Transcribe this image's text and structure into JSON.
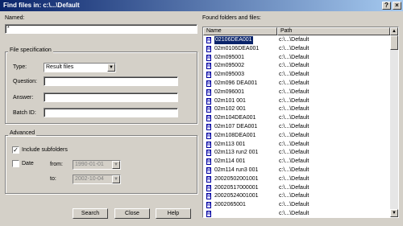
{
  "window": {
    "title": "Find files in: c:\\...\\Default"
  },
  "named": {
    "label": "Named:",
    "value": "*"
  },
  "file_spec": {
    "group_label": "File specification",
    "type_label": "Type:",
    "type_value": "Result files",
    "question_label": "Question:",
    "answer_label": "Answer:",
    "batch_label": "Batch ID:"
  },
  "advanced": {
    "group_label": "Advanced",
    "include_subfolders_label": "Include subfolders",
    "include_subfolders_checked": true,
    "date_label": "Date",
    "date_checked": false,
    "from_label": "from:",
    "from_value": "1990-01-01",
    "to_label": "to:",
    "to_value": "2002-10-04"
  },
  "buttons": {
    "search": "Search",
    "close": "Close",
    "help": "Help"
  },
  "results": {
    "label": "Found folders and files:",
    "columns": [
      "Name",
      "Path"
    ],
    "rows": [
      {
        "name": "02106DEA001",
        "path": "c:\\...\\Default"
      },
      {
        "name": "02m0106DEA001",
        "path": "c:\\...\\Default"
      },
      {
        "name": "02m095001",
        "path": "c:\\...\\Default"
      },
      {
        "name": "02m095002",
        "path": "c:\\...\\Default"
      },
      {
        "name": "02m095003",
        "path": "c:\\...\\Default"
      },
      {
        "name": "02m096 DEA001",
        "path": "c:\\...\\Default"
      },
      {
        "name": "02m096001",
        "path": "c:\\...\\Default"
      },
      {
        "name": "02m101    001",
        "path": "c:\\...\\Default"
      },
      {
        "name": "02m102    001",
        "path": "c:\\...\\Default"
      },
      {
        "name": "02m104DEA001",
        "path": "c:\\...\\Default"
      },
      {
        "name": "02m107 DEA001",
        "path": "c:\\...\\Default"
      },
      {
        "name": "02m108DEA001",
        "path": "c:\\...\\Default"
      },
      {
        "name": "02m113    001",
        "path": "c:\\...\\Default"
      },
      {
        "name": "02m113    run2    001",
        "path": "c:\\...\\Default"
      },
      {
        "name": "02m114    001",
        "path": "c:\\...\\Default"
      },
      {
        "name": "02m114 run3    001",
        "path": "c:\\...\\Default"
      },
      {
        "name": "2002050200​1001",
        "path": "c:\\...\\Default"
      },
      {
        "name": "20020517000001",
        "path": "c:\\...\\Default"
      },
      {
        "name": "20020524001001",
        "path": "c:\\...\\Default"
      },
      {
        "name": "2002065001",
        "path": "c:\\...\\Default"
      },
      {
        "name": "",
        "path": "c:\\...\\Default"
      }
    ]
  }
}
